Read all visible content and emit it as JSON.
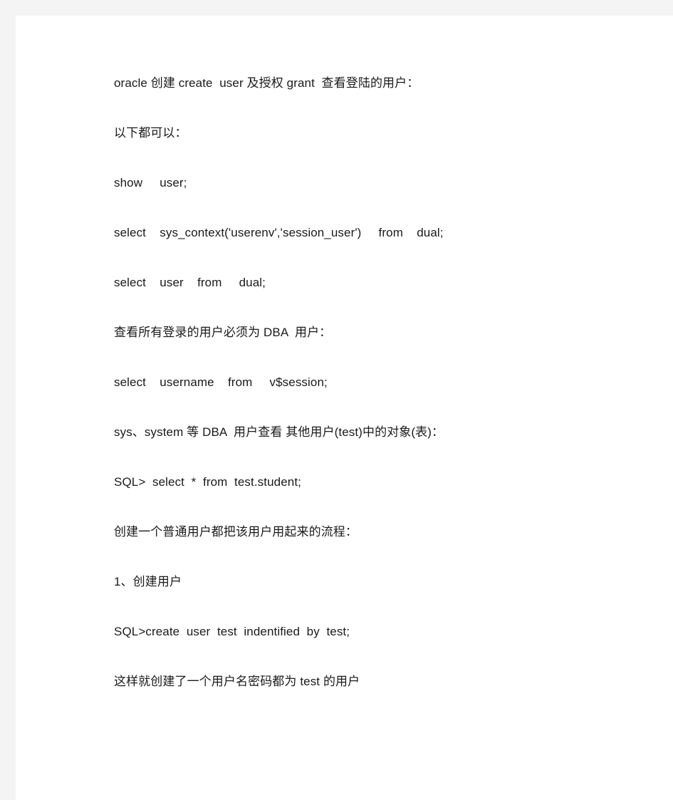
{
  "document": {
    "page_background": "#ffffff",
    "gutter_color": "#f4f4f4",
    "text_color": "#1a1a1a",
    "paragraphs": [
      {
        "id": "p1",
        "text": "oracle 创建 create  user 及授权 grant  查看登陆的用户："
      },
      {
        "id": "p2",
        "text": "以下都可以："
      },
      {
        "id": "p3",
        "text": "show     user;"
      },
      {
        "id": "p4",
        "text": "select    sys_context('userenv','session_user')     from    dual;"
      },
      {
        "id": "p5",
        "text": "select    user    from     dual;"
      },
      {
        "id": "p6",
        "text": "查看所有登录的用户必须为 DBA  用户："
      },
      {
        "id": "p7",
        "text": "select    username    from     v$session;"
      },
      {
        "id": "p8",
        "text": "sys、system 等 DBA  用户查看 其他用户(test)中的对象(表)："
      },
      {
        "id": "p9",
        "text": "SQL>  select  *  from  test.student;"
      },
      {
        "id": "p10",
        "text": "创建一个普通用户都把该用户用起来的流程："
      },
      {
        "id": "p11",
        "text": "1、创建用户"
      },
      {
        "id": "p12",
        "text": "SQL>create  user  test  indentified  by  test;"
      },
      {
        "id": "p13",
        "text": "这样就创建了一个用户名密码都为 test 的用户"
      }
    ]
  }
}
